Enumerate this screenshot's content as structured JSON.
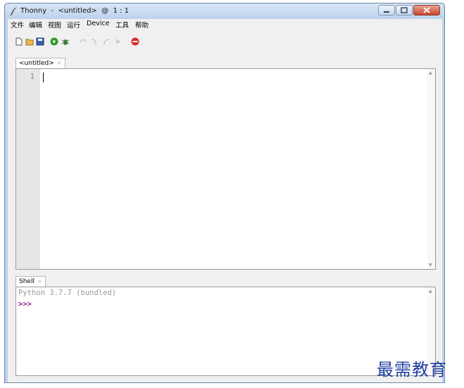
{
  "window": {
    "title": "Thonny  -  <untitled>  @  1 : 1"
  },
  "menu": {
    "items": [
      "文件",
      "编辑",
      "视图",
      "运行",
      "Device",
      "工具",
      "帮助"
    ]
  },
  "toolbar": {
    "icons": [
      "new-file-icon",
      "open-file-icon",
      "save-icon",
      "run-icon",
      "debug-icon",
      "step-over-icon",
      "step-into-icon",
      "step-out-icon",
      "resume-icon",
      "stop-icon"
    ]
  },
  "editor": {
    "tab_label": "<untitled>",
    "tab_close": "×",
    "line_numbers": [
      "1"
    ]
  },
  "shell": {
    "tab_label": "Shell",
    "tab_close": "×",
    "banner": "Python 3.7.7 (bundled)",
    "prompt": ">>>"
  },
  "watermark": {
    "text": "最需教育"
  },
  "colors": {
    "prompt": "#8b1a8b",
    "run": "#2a9a2a",
    "stop": "#d62828"
  }
}
